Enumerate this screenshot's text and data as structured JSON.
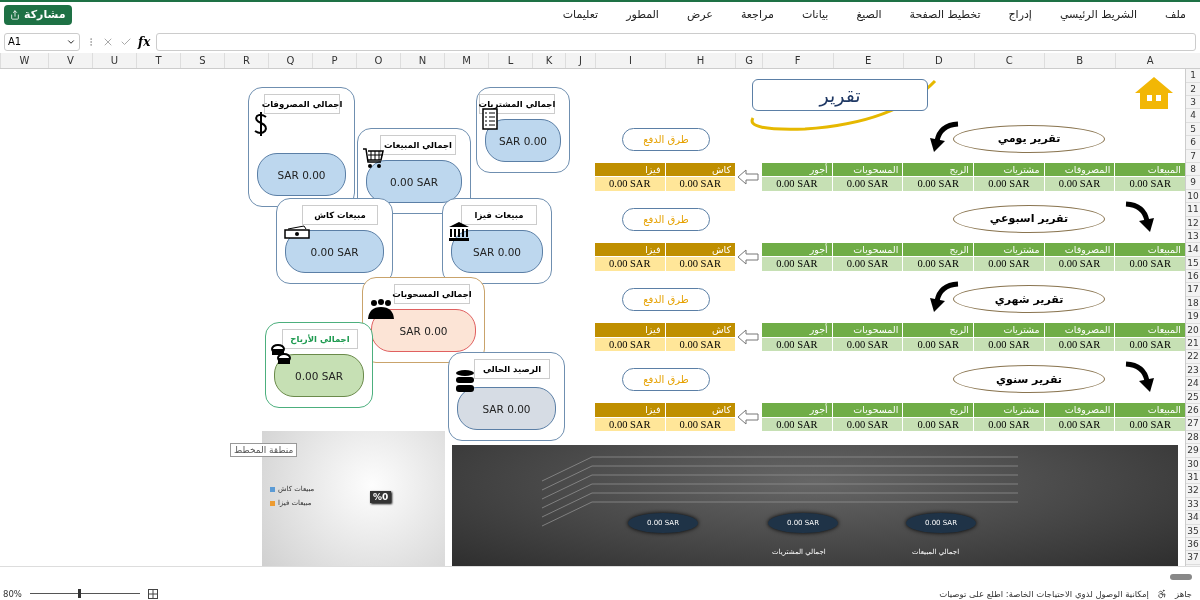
{
  "menu": {
    "items": [
      "ملف",
      "الشريط الرئيسي",
      "إدراج",
      "تخطيط الصفحة",
      "الصيغ",
      "بيانات",
      "مراجعة",
      "عرض",
      "المطور",
      "تعليمات"
    ],
    "share_button": "مشاركة"
  },
  "formula_bar": {
    "name_box": "A1",
    "fx": "fx"
  },
  "column_headers": [
    "A",
    "B",
    "C",
    "D",
    "E",
    "F",
    "G",
    "H",
    "I",
    "J",
    "K",
    "L",
    "M",
    "N",
    "O",
    "P",
    "Q",
    "R",
    "S",
    "T",
    "U",
    "V",
    "W"
  ],
  "row_numbers": [
    "1",
    "2",
    "3",
    "4",
    "5",
    "6",
    "7",
    "8",
    "9",
    "10",
    "11",
    "12",
    "13",
    "14",
    "15",
    "16",
    "17",
    "18",
    "19",
    "20",
    "21",
    "22",
    "23",
    "24",
    "25",
    "26",
    "27",
    "28",
    "29",
    "30",
    "31",
    "32",
    "33",
    "34",
    "35",
    "36",
    "37"
  ],
  "title": "تقرير",
  "reports": [
    {
      "title": "تقرير يومي",
      "payment_label": "طرق الدفع",
      "columns": [
        "المبيعات",
        "المصروفات",
        "مشتريات",
        "الربح",
        "المسحوبات",
        "أجور"
      ],
      "values": [
        "0.00 SAR",
        "0.00 SAR",
        "0.00 SAR",
        "0.00 SAR",
        "0.00 SAR",
        "0.00 SAR"
      ],
      "payment_columns": [
        "كاش",
        "فيزا"
      ],
      "payment_values": [
        "0.00 SAR",
        "0.00 SAR"
      ]
    },
    {
      "title": "تقرير اسبوعي",
      "payment_label": "طرق الدفع",
      "columns": [
        "المبيعات",
        "المصروفات",
        "مشتريات",
        "الربح",
        "المسحوبات",
        "أجور"
      ],
      "values": [
        "0.00 SAR",
        "0.00 SAR",
        "0.00 SAR",
        "0.00 SAR",
        "0.00 SAR",
        "0.00 SAR"
      ],
      "payment_columns": [
        "كاش",
        "فيزا"
      ],
      "payment_values": [
        "0.00 SAR",
        "0.00 SAR"
      ]
    },
    {
      "title": "تقرير شهري",
      "payment_label": "طرق الدفع",
      "columns": [
        "المبيعات",
        "المصروفات",
        "مشتريات",
        "الربح",
        "المسحوبات",
        "أجور"
      ],
      "values": [
        "0.00 SAR",
        "0.00 SAR",
        "0.00 SAR",
        "0.00 SAR",
        "0.00 SAR",
        "0.00 SAR"
      ],
      "payment_columns": [
        "كاش",
        "فيزا"
      ],
      "payment_values": [
        "0.00 SAR",
        "0.00 SAR"
      ]
    },
    {
      "title": "تقرير سنوي",
      "payment_label": "طرق الدفع",
      "columns": [
        "المبيعات",
        "المصروفات",
        "مشتريات",
        "الربح",
        "المسحوبات",
        "أجور"
      ],
      "values": [
        "0.00 SAR",
        "0.00 SAR",
        "0.00 SAR",
        "0.00 SAR",
        "0.00 SAR",
        "0.00 SAR"
      ],
      "payment_columns": [
        "كاش",
        "فيزا"
      ],
      "payment_values": [
        "0.00 SAR",
        "0.00 SAR"
      ]
    }
  ],
  "cards": [
    {
      "title": "اجمالي المشتريات",
      "value": "SAR 0.00",
      "color": "#bdd7ee"
    },
    {
      "title": "اجمالي المصروفات",
      "value": "SAR 0.00",
      "color": "#bdd7ee"
    },
    {
      "title": "اجمالي المبيعات",
      "value": "0.00 SAR",
      "color": "#bdd7ee"
    },
    {
      "title": "مبيعات فيزا",
      "value": "SAR 0.00",
      "color": "#bdd7ee"
    },
    {
      "title": "مبيعات كاش",
      "value": "0.00 SAR",
      "color": "#bdd7ee"
    },
    {
      "title": "اجمالي المسحوبات",
      "value": "SAR 0.00",
      "color": "#fce4d6"
    },
    {
      "title": "اجمالي الأرباح",
      "value": "0.00 SAR",
      "color": "#c6e0b4"
    },
    {
      "title": "الرصيد الحالي",
      "value": "SAR 0.00",
      "color": "#d6dce4"
    }
  ],
  "pie_chart": {
    "tooltip": "منطقة المخطط",
    "data_label": "%0",
    "legend": [
      {
        "label": "مبيعات كاش",
        "color": "#5b9bd5"
      },
      {
        "label": "مبيعات فيزا",
        "color": "#ed9b31"
      }
    ]
  },
  "bar_chart": {
    "data_labels": [
      "0.00 SAR",
      "0.00 SAR",
      "0.00 SAR"
    ],
    "labels": [
      "اجمالي المبيعات",
      "اجمالي المشتريات"
    ]
  },
  "status_bar": {
    "state": "جاهز",
    "accessibility": "إمكانية الوصول لذوي الاحتياجات الخاصة: اطلع على توصيات",
    "zoom": "80%",
    "zoom_slider": {
      "level": 0.45
    }
  }
}
